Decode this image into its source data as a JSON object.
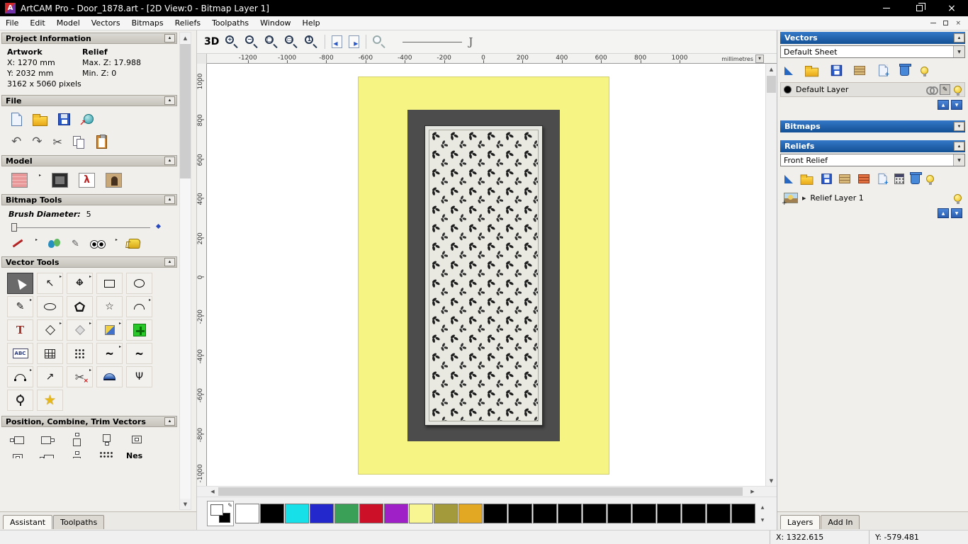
{
  "window": {
    "title": "ArtCAM Pro - Door_1878.art - [2D View:0 - Bitmap Layer 1]",
    "app_initial": "A",
    "controls": [
      "minimize",
      "restore",
      "close"
    ]
  },
  "menu": {
    "items": [
      "File",
      "Edit",
      "Model",
      "Vectors",
      "Bitmaps",
      "Reliefs",
      "Toolpaths",
      "Window",
      "Help"
    ],
    "mdi_controls": [
      "minimize",
      "restore",
      "close"
    ]
  },
  "assistant": {
    "project_information": {
      "title": "Project Information",
      "artwork_heading": "Artwork",
      "relief_heading": "Relief",
      "artwork_x": "X: 1270 mm",
      "relief_max_z": "Max. Z: 17.988",
      "artwork_y": "Y: 2032 mm",
      "relief_min_z": "Min. Z: 0",
      "pixel_size": "3162 x 5060 pixels"
    },
    "file": {
      "title": "File",
      "icons": [
        "new-model-icon",
        "open-model-icon",
        "save-model-icon",
        "import-model-icon",
        "undo-icon",
        "redo-icon",
        "cut-icon",
        "copy-icon",
        "paste-icon"
      ]
    },
    "model": {
      "title": "Model",
      "icons": [
        "set-model-size-icon",
        "greyscale-view-icon",
        "lighting-icon",
        "load-bitmap-icon"
      ]
    },
    "bitmap_tools": {
      "title": "Bitmap Tools",
      "brush_diameter_label": "Brush Diameter:",
      "brush_diameter_value": "5",
      "icons": [
        "paint-brush-icon",
        "paint-selective-icon",
        "draw-pencil-icon",
        "colour-eyes-icon",
        "flood-fill-icon"
      ]
    },
    "vector_tools": {
      "title": "Vector Tools",
      "icons": [
        "select-vectors",
        "node-editing",
        "transform-vectors",
        "create-rectangle",
        "create-ellipse",
        "create-polyline",
        "create-oval",
        "create-polygon",
        "create-star",
        "create-arc",
        "create-text",
        "offset-vectors",
        "create-diamond",
        "fillet-vectors",
        "paste-vectors",
        "text-block",
        "snap-grid",
        "point-array",
        "curve-node-edit",
        "curve-smooth",
        "arc-through-points",
        "direction-arrow",
        "trim-vectors",
        "extrude-dome",
        "branch-vectors",
        "vector-doctor",
        "wrap-star"
      ]
    },
    "position_combine": {
      "title": "Position, Combine, Trim Vectors",
      "icons": [
        "align-left-icon",
        "align-right-icon",
        "align-top-icon",
        "align-bottom-icon",
        "align-centre-icon"
      ],
      "clipped_label": "Nes"
    },
    "tabs": [
      {
        "label": "Assistant",
        "active": true
      },
      {
        "label": "Toolpaths",
        "active": false
      }
    ]
  },
  "viewport": {
    "toolbar": {
      "label_3d": "3D",
      "icons": [
        "view-3d-button",
        "zoom-in-icon",
        "zoom-out-icon",
        "zoom-window-icon",
        "zoom-extents-icon",
        "zoom-1to1-icon",
        "page-left-icon",
        "page-right-icon",
        "zoom-previous-icon",
        "line-width-preview",
        "curve-preview-icon"
      ]
    },
    "h_ruler": {
      "ticks": [
        "-1200",
        "-1000",
        "-800",
        "-600",
        "-400",
        "-200",
        "0",
        "200",
        "400",
        "600",
        "800",
        "1000"
      ],
      "unit": "millimetres"
    },
    "v_ruler": {
      "ticks": [
        "1000",
        "800",
        "600",
        "400",
        "200",
        "0",
        "-200",
        "-400",
        "-600",
        "-800",
        "-1000"
      ]
    },
    "palette": {
      "swatches": [
        {
          "name": "white",
          "color": "#ffffff"
        },
        {
          "name": "black",
          "color": "#000000"
        },
        {
          "name": "cyan",
          "color": "#18e0e8"
        },
        {
          "name": "blue",
          "color": "#2228cc"
        },
        {
          "name": "green",
          "color": "#3aa058"
        },
        {
          "name": "red",
          "color": "#cc1028"
        },
        {
          "name": "magenta",
          "color": "#a020c8"
        },
        {
          "name": "pale-yellow",
          "color": "#f8f692"
        },
        {
          "name": "olive",
          "color": "#a39a3c"
        },
        {
          "name": "gold",
          "color": "#e2a824"
        },
        {
          "name": "black",
          "color": "#000000"
        },
        {
          "name": "black",
          "color": "#000000"
        },
        {
          "name": "black",
          "color": "#000000"
        },
        {
          "name": "black",
          "color": "#000000"
        },
        {
          "name": "black",
          "color": "#000000"
        },
        {
          "name": "black",
          "color": "#000000"
        },
        {
          "name": "black",
          "color": "#000000"
        },
        {
          "name": "black",
          "color": "#000000"
        },
        {
          "name": "black",
          "color": "#000000"
        },
        {
          "name": "black",
          "color": "#000000"
        },
        {
          "name": "black",
          "color": "#000000"
        }
      ]
    }
  },
  "layers_panel": {
    "vectors": {
      "title": "Vectors",
      "sheet": "Default Sheet",
      "layer_name": "Default Layer",
      "toolbar_icons": [
        "new-vector-layer-icon",
        "open-layer-icon",
        "save-layer-icon",
        "merge-layers-icon",
        "new-sheet-icon",
        "delete-layer-icon",
        "toggle-all-visibility-icon"
      ],
      "row_icons": [
        "link-layer-icon",
        "edit-layer-icon",
        "layer-visibility-bulb-icon"
      ]
    },
    "bitmaps": {
      "title": "Bitmaps"
    },
    "reliefs": {
      "title": "Reliefs",
      "relief": "Front Relief",
      "layer_name": "Relief Layer 1",
      "toolbar_icons": [
        "new-relief-layer-icon",
        "open-relief-icon",
        "save-relief-icon",
        "merge-relief-icon",
        "transfer-relief-icon",
        "duplicate-relief-icon",
        "calculate-relief-icon",
        "delete-relief-icon",
        "toggle-relief-visibility-icon"
      ],
      "row_icons": [
        "relief-thumbnail",
        "expand-arrow-icon",
        "relief-visibility-bulb-icon"
      ]
    },
    "tabs": [
      {
        "label": "Layers",
        "active": true
      },
      {
        "label": "Add In",
        "active": false
      }
    ]
  },
  "status_bar": {
    "x_readout": "X: 1322.615",
    "y_readout": "Y: -579.481"
  }
}
